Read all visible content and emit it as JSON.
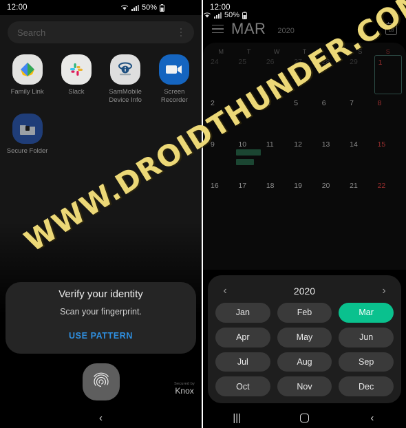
{
  "left_screen": {
    "statusbar": {
      "clock": "12:00",
      "battery_percent": "50%",
      "wifi_icon": "wifi-icon",
      "signal_icon": "signal-bars-icon",
      "battery_icon": "battery-icon"
    },
    "search": {
      "placeholder": "Search",
      "menu_icon": "kebab-menu-icon"
    },
    "apps": [
      {
        "label": "Family Link",
        "icon": "family-link-icon"
      },
      {
        "label": "Slack",
        "icon": "slack-icon"
      },
      {
        "label": "SamMobile Device Info",
        "icon": "sammobile-device-info-icon"
      },
      {
        "label": "Screen Recorder",
        "icon": "screen-recorder-icon"
      },
      {
        "label": "Secure Folder",
        "icon": "secure-folder-icon"
      }
    ],
    "fingerprint_dialog": {
      "title": "Verify your identity",
      "subtitle": "Scan your fingerprint.",
      "action": "USE PATTERN",
      "fingerprint_icon": "fingerprint-icon"
    },
    "knox": {
      "secured_by": "Secured by",
      "brand": "Knox"
    },
    "navbar": {
      "back_label": "‹"
    }
  },
  "right_screen": {
    "statusbar": {
      "clock": "12:00",
      "battery_percent": "50%"
    },
    "header": {
      "menu_icon": "hamburger-menu-icon",
      "month": "MAR",
      "year": "2020",
      "today_icon": "calendar-today-icon",
      "today_day": "18"
    },
    "calendar": {
      "day_headers": [
        "M",
        "T",
        "W",
        "T",
        "F",
        "S",
        "S"
      ],
      "weeks": [
        [
          {
            "d": "24",
            "muted": true
          },
          {
            "d": "25",
            "muted": true
          },
          {
            "d": "26",
            "muted": true
          },
          {
            "d": "27",
            "muted": true
          },
          {
            "d": "28",
            "muted": true
          },
          {
            "d": "29",
            "muted": true
          },
          {
            "d": "1",
            "sunday": true,
            "selected": true
          }
        ],
        [
          {
            "d": "2"
          },
          {
            "d": "3"
          },
          {
            "d": "4"
          },
          {
            "d": "5"
          },
          {
            "d": "6"
          },
          {
            "d": "7"
          },
          {
            "d": "8",
            "sunday": true
          }
        ],
        [
          {
            "d": "9"
          },
          {
            "d": "10"
          },
          {
            "d": "11"
          },
          {
            "d": "12"
          },
          {
            "d": "13"
          },
          {
            "d": "14"
          },
          {
            "d": "15",
            "sunday": true
          }
        ],
        [
          {
            "d": "16"
          },
          {
            "d": "17"
          },
          {
            "d": "18"
          },
          {
            "d": "19"
          },
          {
            "d": "20"
          },
          {
            "d": "21"
          },
          {
            "d": "22",
            "sunday": true
          }
        ]
      ]
    },
    "month_picker": {
      "prev_label": "‹",
      "next_label": "›",
      "year": "2020",
      "months": [
        "Jan",
        "Feb",
        "Mar",
        "Apr",
        "May",
        "Jun",
        "Jul",
        "Aug",
        "Sep",
        "Oct",
        "Nov",
        "Dec"
      ],
      "selected_month": "Mar",
      "accent_color": "#0ac18e"
    },
    "navbar": {
      "recents_label": "|||",
      "home_icon": "home-square-icon",
      "back_label": "‹"
    }
  },
  "watermark": {
    "text": "WWW.DROIDTHUNDER.COM",
    "color": "#ecd877"
  }
}
